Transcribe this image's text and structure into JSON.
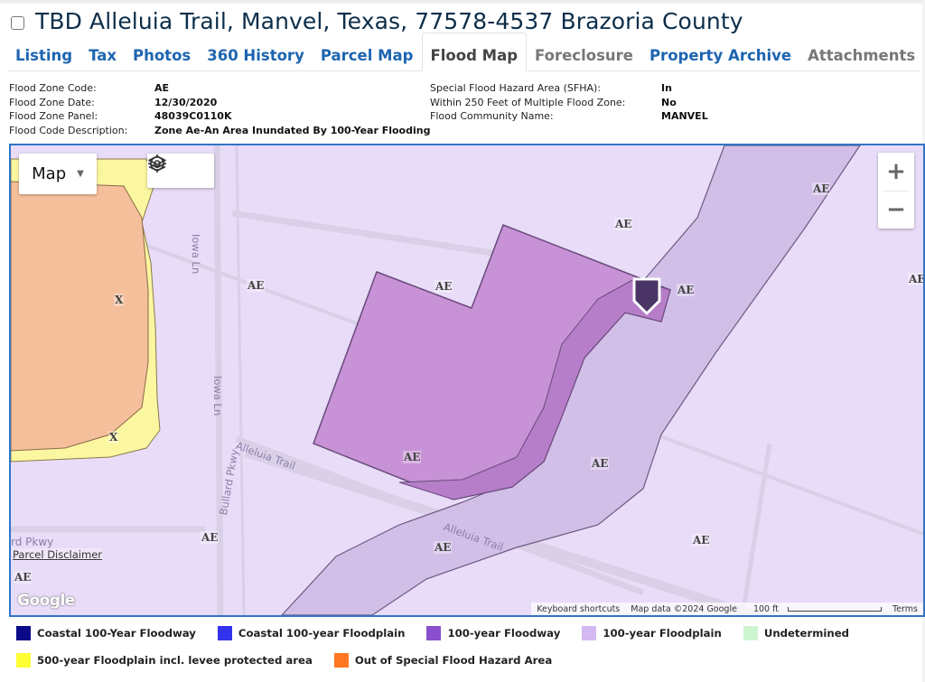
{
  "header": {
    "title": "TBD Alleluia Trail, Manvel, Texas, 77578-4537 Brazoria County"
  },
  "tabs": [
    {
      "label": "Listing",
      "state": "link"
    },
    {
      "label": "Tax",
      "state": "link"
    },
    {
      "label": "Photos",
      "state": "link"
    },
    {
      "label": "360 History",
      "state": "link"
    },
    {
      "label": "Parcel Map",
      "state": "link"
    },
    {
      "label": "Flood Map",
      "state": "active"
    },
    {
      "label": "Foreclosure",
      "state": "disabled"
    },
    {
      "label": "Property Archive",
      "state": "link"
    },
    {
      "label": "Attachments",
      "state": "disabled"
    }
  ],
  "flood_info": {
    "left": [
      {
        "label": "Flood Zone Code:",
        "value": "AE"
      },
      {
        "label": "Flood Zone Date:",
        "value": "12/30/2020"
      },
      {
        "label": "Flood Zone Panel:",
        "value": "48039C0110K"
      },
      {
        "label": "Flood Code Description:",
        "value": "Zone Ae-An Area Inundated By 100-Year Flooding"
      }
    ],
    "right": [
      {
        "label": "Special Flood Hazard Area (SFHA):",
        "value": "In"
      },
      {
        "label": "Within 250 Feet of Multiple Flood Zone:",
        "value": "No"
      },
      {
        "label": "Flood Community Name:",
        "value": "MANVEL"
      }
    ]
  },
  "map": {
    "map_type_label": "Map",
    "layers_icon": "layers-icon",
    "locate_icon": "locate-target-icon",
    "zoom_in_label": "+",
    "zoom_out_label": "−",
    "zone_labels": {
      "x": "X",
      "ae": "AE"
    },
    "roads": {
      "iowa": "Iowa Ln",
      "bullard": "Bullard Pkwy",
      "alleluia": "Alleluia Trail",
      "partial": "rd Pkwy"
    },
    "parcel_disclaimer": "Parcel Disclaimer",
    "google_logo": "Google",
    "attribution": {
      "shortcuts": "Keyboard shortcuts",
      "map_data": "Map data ©2024 Google",
      "scale": "100 ft",
      "terms": "Terms"
    },
    "colors": {
      "background_floodplain": "#e8dcf8",
      "floodway_band": "#d2bfe8",
      "parcel": "#c792d6",
      "parcel_floodway_overlap": "#b67ec8",
      "out_of_sfha": "#f5bf9c",
      "zone_500yr": "#fbf6a0",
      "marker": "#4b3566",
      "map_border": "#2f75c8"
    }
  },
  "legend": {
    "row1": [
      {
        "label": "Coastal 100-Year Floodway",
        "color": "#0a0a8a"
      },
      {
        "label": "Coastal 100-year Floodplain",
        "color": "#3333ee"
      },
      {
        "label": "100-year Floodway",
        "color": "#8a4fcf"
      },
      {
        "label": "100-year Floodplain",
        "color": "#d4b8f2"
      },
      {
        "label": "Undetermined",
        "color": "#cdf5cf"
      }
    ],
    "row2": [
      {
        "label": "500-year Floodplain incl. levee protected area",
        "color": "#ffff33"
      },
      {
        "label": "Out of Special Flood Hazard Area",
        "color": "#ff7722"
      }
    ]
  }
}
